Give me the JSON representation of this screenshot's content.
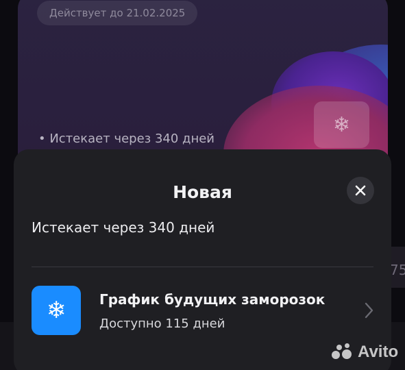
{
  "background_card": {
    "valid_until": "Действует до 21.02.2025",
    "expires_text": "• Истекает через 340 дней",
    "freeze_icon": "snowflake-icon",
    "side_text": "75"
  },
  "sheet": {
    "title": "Новая",
    "subtitle": "Истекает через 340 дней",
    "close_icon": "close-icon",
    "freeze_item": {
      "icon": "snowflake-icon",
      "title": "График будущих заморозок",
      "subtitle": "Доступно 115 дней",
      "chevron_icon": "chevron-right-icon"
    }
  },
  "watermark": {
    "text": "Avito"
  },
  "colors": {
    "sheet_bg": "#1f1f23",
    "accent_blue": "#1a8cff",
    "close_bg": "#34343a"
  }
}
